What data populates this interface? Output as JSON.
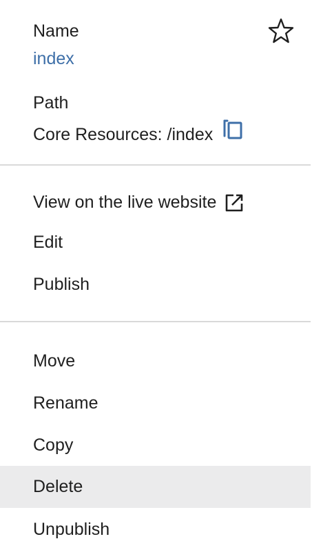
{
  "info": {
    "name_label": "Name",
    "name_value": "index",
    "path_label": "Path",
    "path_value": "Core Resources: /index"
  },
  "menu_group_1": [
    {
      "label": "View on the live website",
      "icon": "external-link-icon"
    },
    {
      "label": "Edit"
    },
    {
      "label": "Publish"
    }
  ],
  "menu_group_2": [
    {
      "label": "Move"
    },
    {
      "label": "Rename"
    },
    {
      "label": "Copy"
    },
    {
      "label": "Delete",
      "highlighted": true
    },
    {
      "label": "Unpublish"
    }
  ],
  "colors": {
    "link": "#3e6fa8",
    "text": "#1f1f1f",
    "divider": "#d9d9d9",
    "highlight_bg": "#ebebec"
  },
  "icons": {
    "favorite": "star-outline-icon",
    "copy_path": "copy-icon",
    "external": "external-link-icon"
  }
}
